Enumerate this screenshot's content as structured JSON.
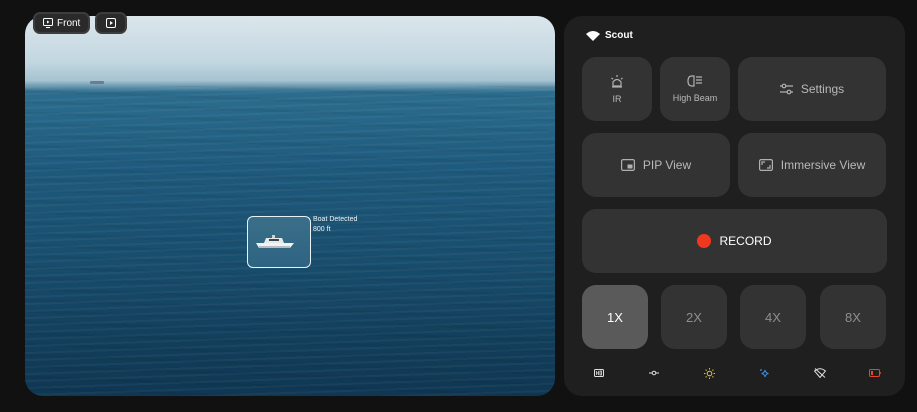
{
  "camera": {
    "source_label": "Front",
    "detection": {
      "title": "Boat Detected",
      "distance": "800 ft"
    }
  },
  "panel": {
    "brand": "Scout",
    "buttons": {
      "ir": "IR",
      "high_beam": "High Beam",
      "settings": "Settings",
      "pip_view": "PIP View",
      "immersive_view": "Immersive View",
      "record": "RECORD"
    },
    "zoom_levels": [
      "1X",
      "2X",
      "4X",
      "8X"
    ],
    "zoom_selected": "1X",
    "status_icons": [
      "hd-icon",
      "gimbal-icon",
      "sun-icon",
      "sparkle-icon",
      "no-wifi-icon",
      "battery-low-icon"
    ],
    "colors": {
      "record": "#f0381f",
      "sun": "#e6c12f",
      "sparkle": "#3a8de0",
      "battery": "#e5442f"
    }
  }
}
